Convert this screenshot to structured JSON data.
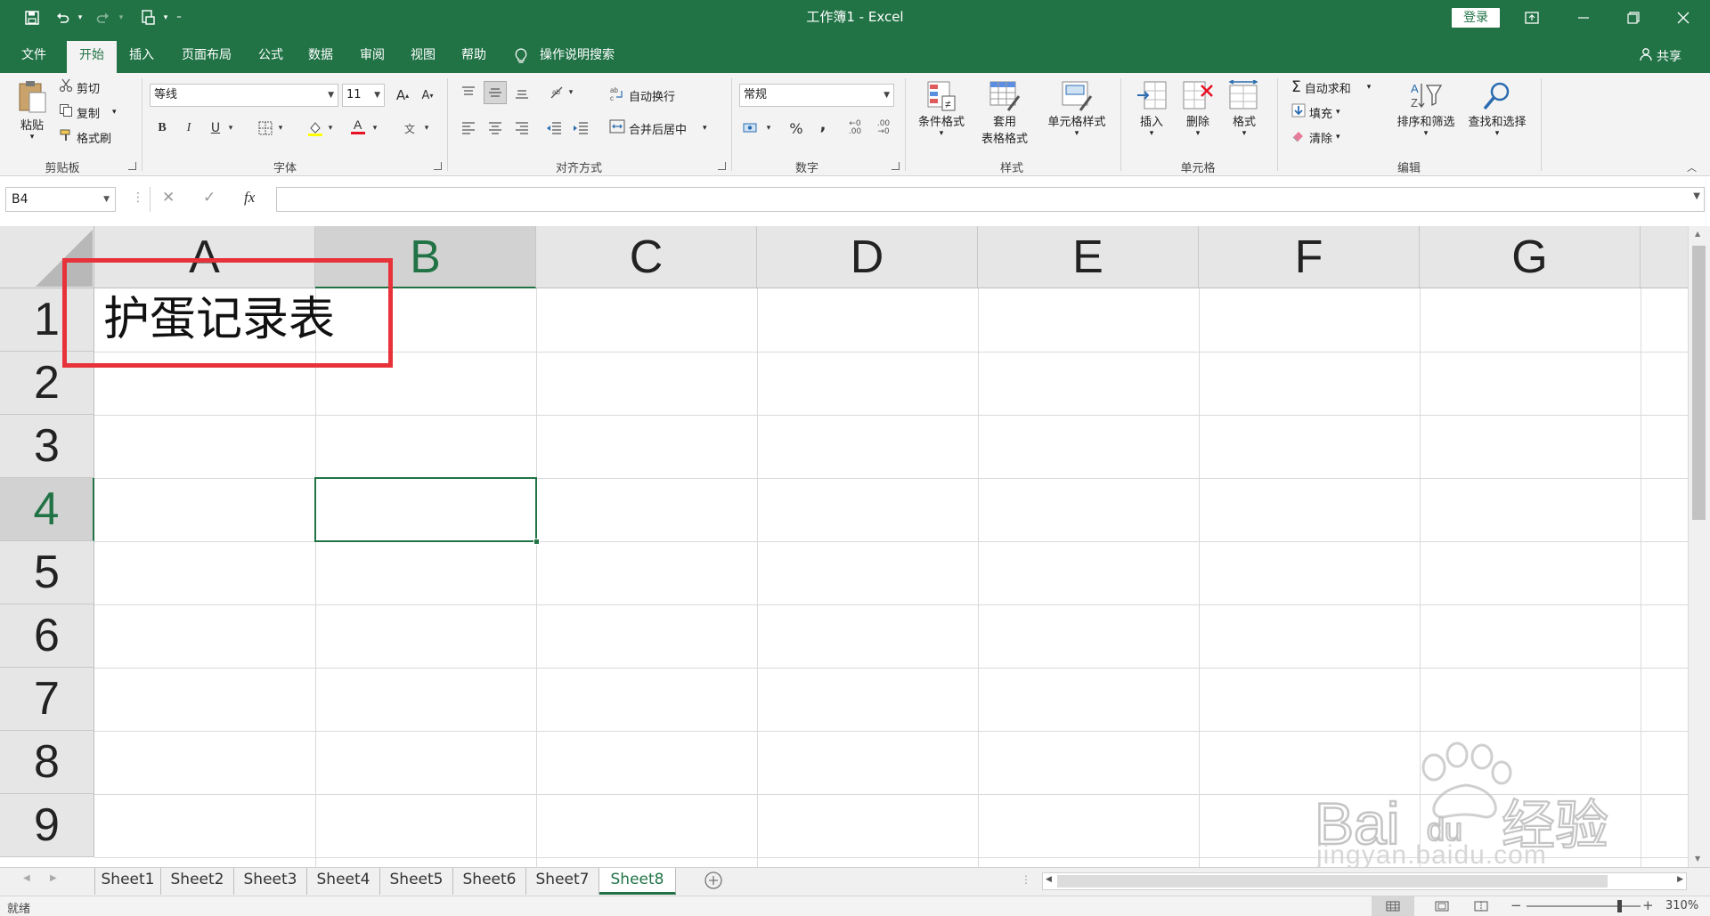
{
  "window": {
    "title": "工作簿1  -  Excel",
    "login_label": "登录",
    "share_label": "共享"
  },
  "tabs": [
    "文件",
    "开始",
    "插入",
    "页面布局",
    "公式",
    "数据",
    "审阅",
    "视图",
    "帮助"
  ],
  "active_tab": "开始",
  "tell_me": "操作说明搜索",
  "ribbon": {
    "clipboard": {
      "paste": "粘贴",
      "cut": "剪切",
      "copy": "复制",
      "format_painter": "格式刷",
      "label": "剪贴板"
    },
    "font": {
      "name": "等线",
      "size": "11",
      "label": "字体",
      "bold": "B",
      "italic": "I",
      "underline": "U",
      "wen": "文"
    },
    "alignment": {
      "wrap_text": "自动换行",
      "merge_center": "合并后居中",
      "label": "对齐方式"
    },
    "number": {
      "format": "常规",
      "label": "数字",
      "percent": "%",
      "comma": ","
    },
    "styles": {
      "conditional": "条件格式",
      "table_format_1": "套用",
      "table_format_2": "表格格式",
      "cell_styles": "单元格样式",
      "label": "样式"
    },
    "cells": {
      "insert": "插入",
      "delete": "删除",
      "format": "格式",
      "label": "单元格"
    },
    "editing": {
      "autosum": "自动求和",
      "fill": "填充",
      "clear": "清除",
      "sort_filter": "排序和筛选",
      "find_select": "查找和选择",
      "label": "编辑"
    }
  },
  "formula_bar": {
    "name_box": "B4",
    "fx": "fx",
    "formula": ""
  },
  "grid": {
    "columns": [
      "A",
      "B",
      "C",
      "D",
      "E",
      "F",
      "G"
    ],
    "rows": [
      "1",
      "2",
      "3",
      "4",
      "5",
      "6",
      "7",
      "8",
      "9"
    ],
    "selected_cell": "B4",
    "cell_a1": "护蛋记录表"
  },
  "sheets": [
    "Sheet1",
    "Sheet2",
    "Sheet3",
    "Sheet4",
    "Sheet5",
    "Sheet6",
    "Sheet7",
    "Sheet8"
  ],
  "active_sheet": "Sheet8",
  "status": {
    "ready": "就绪",
    "zoom": "310%"
  },
  "watermark": {
    "brand": "Bai du",
    "product": "经验",
    "url": "jingyan.baidu.com"
  },
  "colors": {
    "accent": "#217346",
    "highlight": "#e8323a"
  }
}
